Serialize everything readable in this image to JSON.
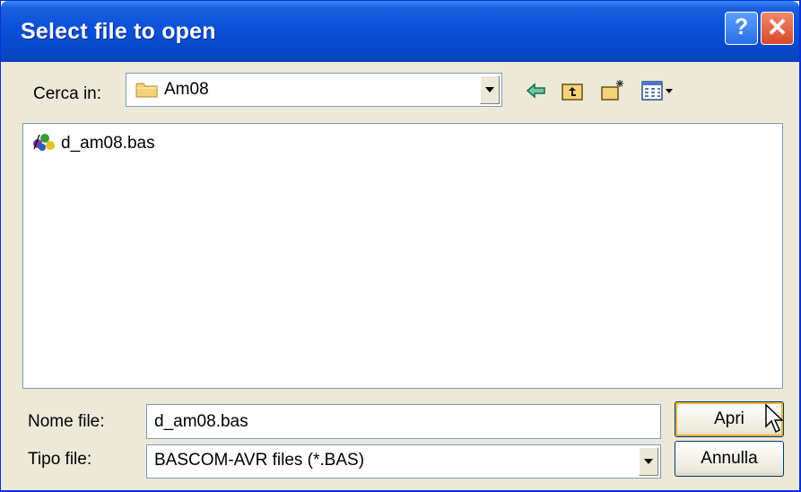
{
  "window": {
    "title": "Select file to open"
  },
  "titlebar": {
    "help_glyph": "?",
    "close_glyph": "✕"
  },
  "lookin": {
    "label": "Cerca in:",
    "value": "Am08",
    "icon": "folder-icon"
  },
  "toolbar": {
    "icons": [
      "back-arrow-icon",
      "up-folder-icon",
      "new-folder-icon",
      "view-menu-icon"
    ]
  },
  "files": [
    {
      "name": "d_am08.bas",
      "icon": "bascom-file-icon"
    }
  ],
  "filename": {
    "label": "Nome file:",
    "value": "d_am08.bas"
  },
  "filetype": {
    "label": "Tipo file:",
    "value": "BASCOM-AVR files (*.BAS)"
  },
  "buttons": {
    "open": "Apri",
    "cancel": "Annulla"
  },
  "colors": {
    "titlebar": "#0a50d8",
    "dialog_bg": "#ece9d8",
    "close": "#d8482a"
  }
}
